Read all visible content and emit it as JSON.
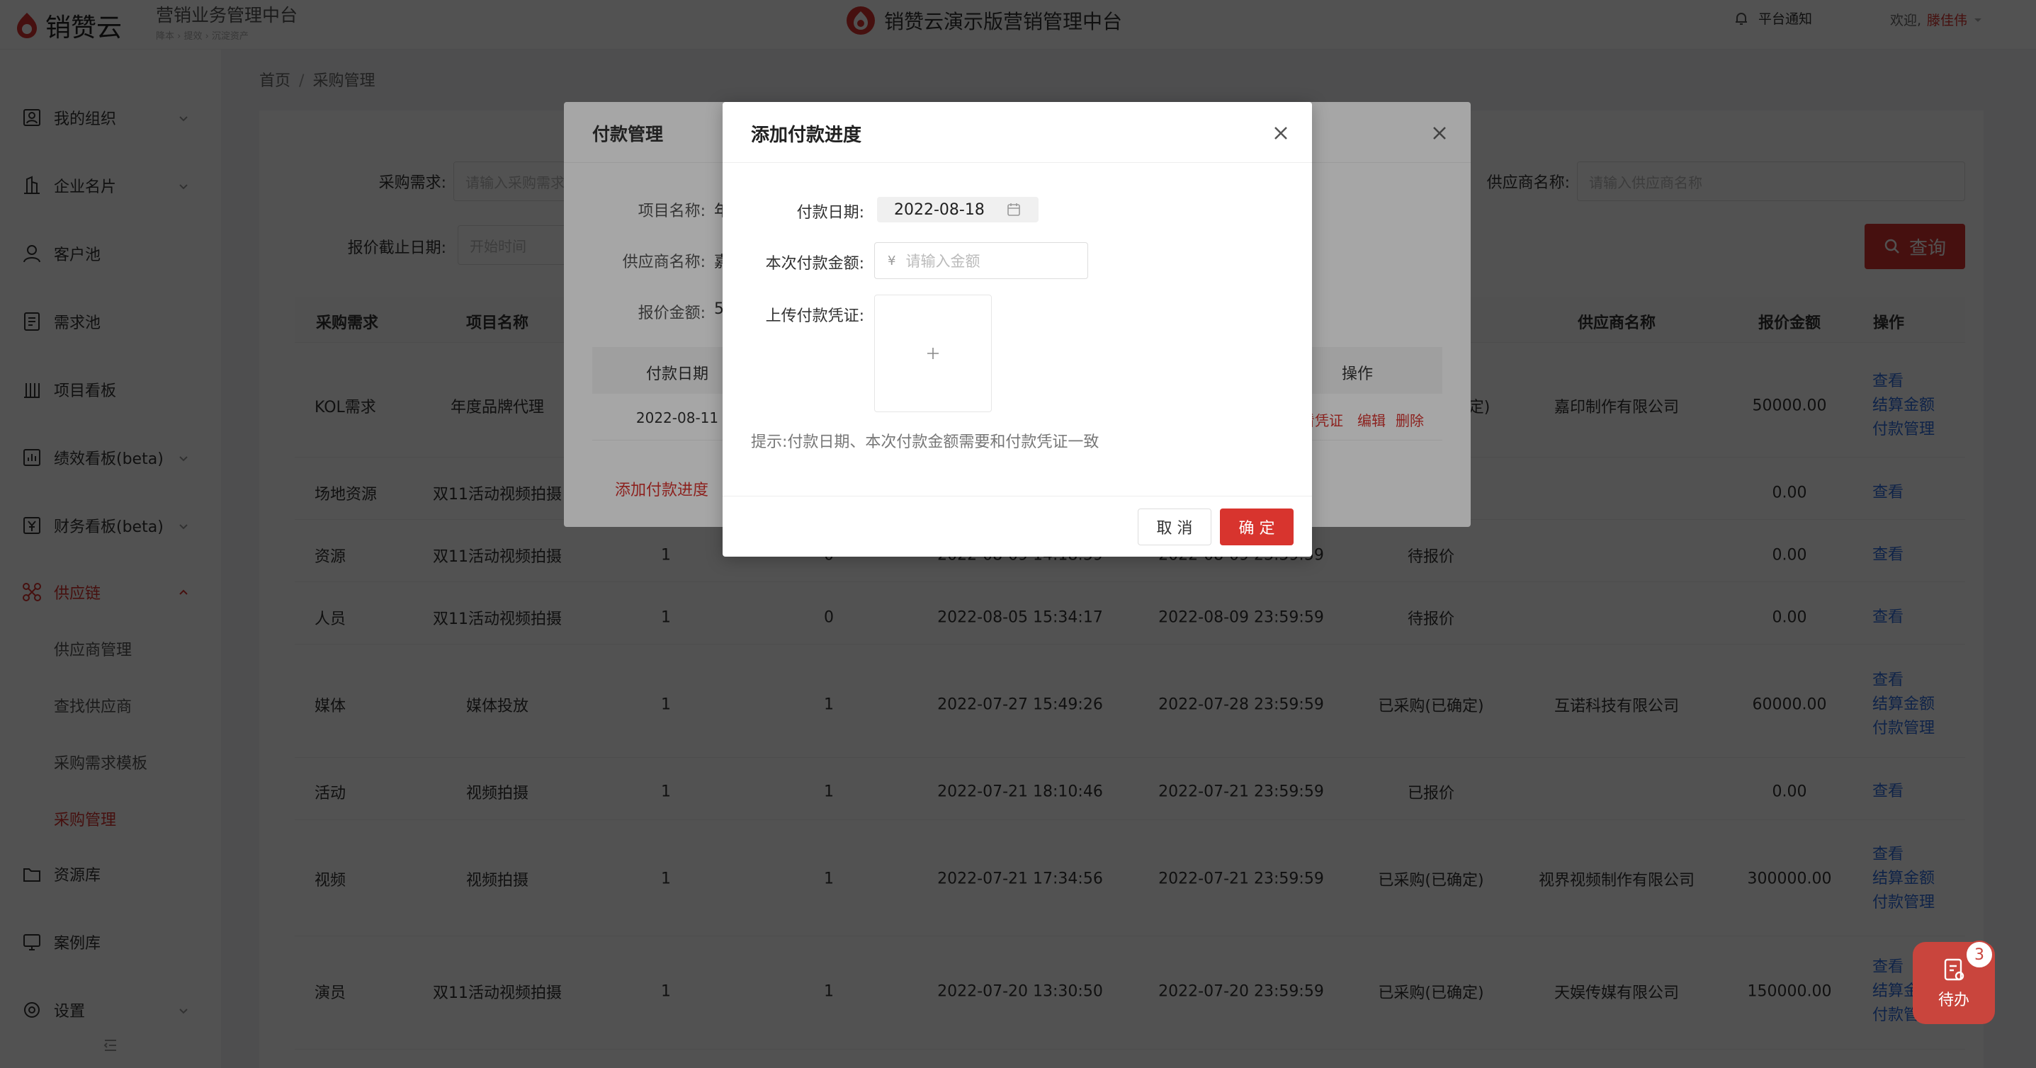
{
  "header": {
    "logo_text": "销赞云",
    "system_title": "营销业务管理中台",
    "system_subtitle": "降本 › 提效 › 沉淀资产",
    "center_title": "销赞云演示版营销管理中台",
    "notice_label": "平台通知",
    "welcome_prefix": "欢迎,",
    "user_name": "滕佳伟"
  },
  "sidebar": {
    "items": [
      {
        "label": "我的组织",
        "icon": "org-icon"
      },
      {
        "label": "企业名片",
        "icon": "building-icon"
      },
      {
        "label": "客户池",
        "icon": "user-icon"
      },
      {
        "label": "需求池",
        "icon": "doc-icon"
      },
      {
        "label": "项目看板",
        "icon": "board-icon"
      },
      {
        "label": "绩效看板(beta)",
        "icon": "chart-icon"
      },
      {
        "label": "财务看板(beta)",
        "icon": "finance-icon"
      },
      {
        "label": "供应链",
        "icon": "supply-chain-icon"
      },
      {
        "label": "资源库",
        "icon": "folder-icon"
      },
      {
        "label": "案例库",
        "icon": "case-icon"
      },
      {
        "label": "设置",
        "icon": "settings-icon"
      }
    ],
    "sub_items": [
      "供应商管理",
      "查找供应商",
      "采购需求模板",
      "采购管理"
    ]
  },
  "breadcrumb": {
    "home": "首页",
    "separator": "/",
    "current": "采购管理"
  },
  "filters": {
    "demand_label": "采购需求:",
    "demand_placeholder": "请输入采购需求",
    "supplier_label": "供应商名称:",
    "supplier_placeholder": "请输入供应商名称",
    "deadline_label": "报价截止日期:",
    "deadline_placeholder": "开始时间",
    "query_button": "查询"
  },
  "table": {
    "columns": {
      "demand": "采购需求",
      "project": "项目名称",
      "supplier": "供应商名称",
      "amount": "报价金额",
      "ops": "操作"
    },
    "rows": [
      {
        "demand": "KOL需求",
        "project": "年度品牌代理",
        "qty": "",
        "quoted": "",
        "created": "",
        "deadline": "",
        "status": "定)",
        "supplier": "嘉印制作有限公司",
        "amount": "50000.00",
        "actions": [
          "查看",
          "结算金额",
          "付款管理"
        ]
      },
      {
        "demand": "场地资源",
        "project": "双11活动视频拍摄",
        "qty": "",
        "quoted": "",
        "created": "",
        "deadline": "",
        "status": "",
        "supplier": "",
        "amount": "0.00",
        "actions": [
          "查看"
        ]
      },
      {
        "demand": "资源",
        "project": "双11活动视频拍摄",
        "qty": "1",
        "quoted": "0",
        "created": "2022-08-09 14:18:59",
        "deadline": "2022-08-09 23:59:59",
        "status": "待报价",
        "supplier": "",
        "amount": "0.00",
        "actions": [
          "查看"
        ]
      },
      {
        "demand": "人员",
        "project": "双11活动视频拍摄",
        "qty": "1",
        "quoted": "0",
        "created": "2022-08-05 15:34:17",
        "deadline": "2022-08-09 23:59:59",
        "status": "待报价",
        "supplier": "",
        "amount": "0.00",
        "actions": [
          "查看"
        ]
      },
      {
        "demand": "媒体",
        "project": "媒体投放",
        "qty": "1",
        "quoted": "1",
        "created": "2022-07-27 15:49:26",
        "deadline": "2022-07-28 23:59:59",
        "status": "已采购(已确定)",
        "supplier": "互诺科技有限公司",
        "amount": "60000.00",
        "actions": [
          "查看",
          "结算金额",
          "付款管理"
        ]
      },
      {
        "demand": "活动",
        "project": "视频拍摄",
        "qty": "1",
        "quoted": "1",
        "created": "2022-07-21 18:10:46",
        "deadline": "2022-07-21 23:59:59",
        "status": "已报价",
        "supplier": "",
        "amount": "0.00",
        "actions": [
          "查看"
        ]
      },
      {
        "demand": "视频",
        "project": "视频拍摄",
        "qty": "1",
        "quoted": "1",
        "created": "2022-07-21 17:34:56",
        "deadline": "2022-07-21 23:59:59",
        "status": "已采购(已确定)",
        "supplier": "视界视频制作有限公司",
        "amount": "300000.00",
        "actions": [
          "查看",
          "结算金额",
          "付款管理"
        ]
      },
      {
        "demand": "演员",
        "project": "双11活动视频拍摄",
        "qty": "1",
        "quoted": "1",
        "created": "2022-07-20 13:30:50",
        "deadline": "2022-07-20 23:59:59",
        "status": "已采购(已确定)",
        "supplier": "天娱传媒有限公司",
        "amount": "150000.00",
        "actions": [
          "查看",
          "结算金额",
          "付款管理"
        ]
      }
    ]
  },
  "payment_modal": {
    "title": "付款管理",
    "project_label": "项目名称:",
    "project_value": "年",
    "supplier_label": "供应商名称:",
    "supplier_value": "嘉",
    "amount_label": "报价金额:",
    "amount_value": "5",
    "columns": {
      "date": "付款日期",
      "ops": "操作"
    },
    "row": {
      "date": "2022-08-11",
      "view_voucher": "看凭证",
      "edit": "编辑",
      "delete": "删除"
    },
    "add_link": "添加付款进度"
  },
  "add_modal": {
    "title": "添加付款进度",
    "date_label": "付款日期:",
    "date_value": "2022-08-18",
    "amount_label": "本次付款金额:",
    "currency": "¥",
    "amount_placeholder": "请输入金额",
    "upload_label": "上传付款凭证:",
    "tip": "提示:付款日期、本次付款金额需要和付款凭证一致",
    "cancel": "取 消",
    "ok": "确 定"
  },
  "todo": {
    "label": "待办",
    "count": "3"
  }
}
